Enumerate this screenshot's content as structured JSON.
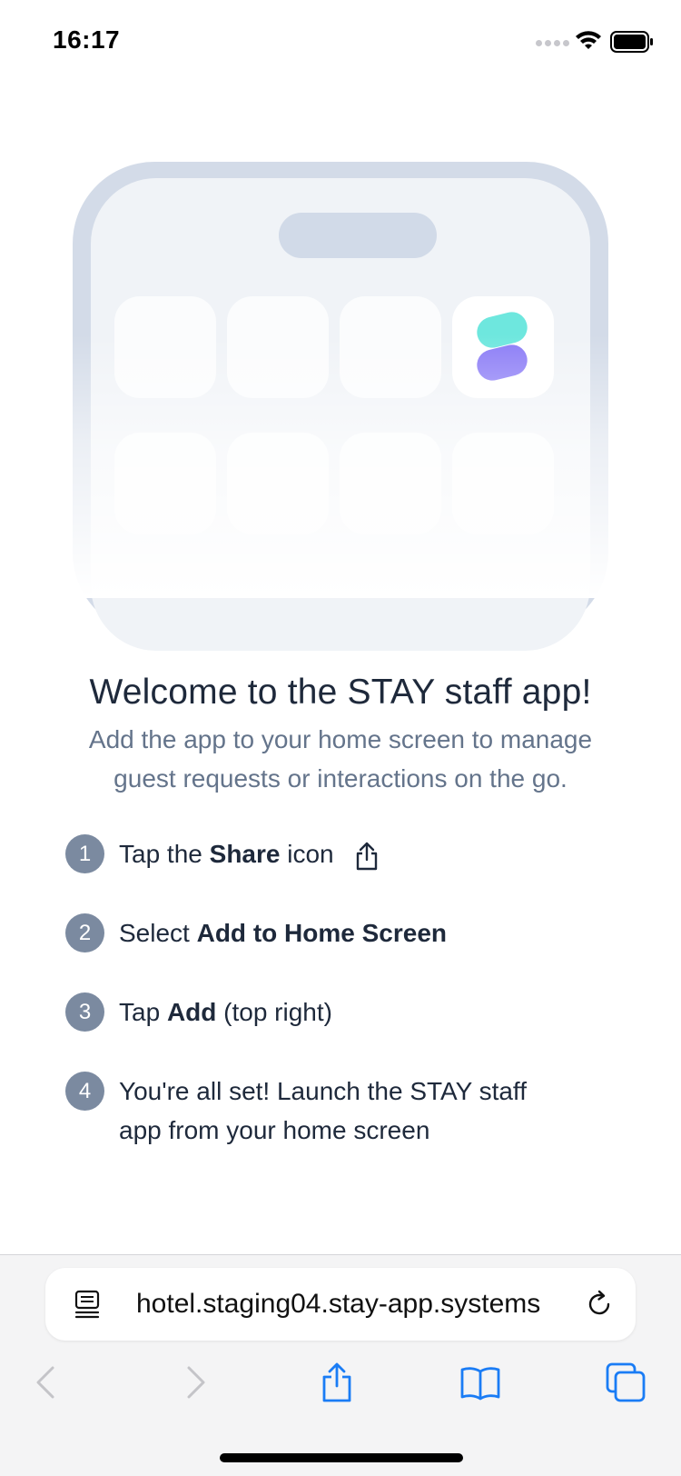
{
  "status_bar": {
    "time": "16:17",
    "icons": [
      "signal-dots-icon",
      "wifi-icon",
      "battery-icon"
    ]
  },
  "illustration": {
    "app_icon": "stay-logo-icon",
    "colors": {
      "frame": "#d3dbe8",
      "screen": "#f0f3f7",
      "logo_teal": "#6ee7de",
      "logo_purple": "#8b7cf6"
    }
  },
  "welcome": {
    "title": "Welcome to the STAY staff app!",
    "subtitle_line1": "Add the app to your home screen to manage",
    "subtitle_line2": "guest requests or interactions on the go."
  },
  "steps": [
    {
      "number": "1",
      "pre": "Tap the ",
      "bold": "Share",
      "post": " icon",
      "icon": "share-icon"
    },
    {
      "number": "2",
      "pre": "Select ",
      "bold": "Add to Home Screen",
      "post": ""
    },
    {
      "number": "3",
      "pre": "Tap ",
      "bold": "Add",
      "post": " (top right)"
    },
    {
      "number": "4",
      "line1": "You're all set! Launch the STAY staff",
      "line2": "app from your home screen"
    }
  ],
  "browser": {
    "url": "hotel.staging04.stay-app.systems",
    "toolbar": [
      "back-icon",
      "forward-icon",
      "share-icon",
      "bookmarks-icon",
      "tabs-icon"
    ],
    "accent_color": "#1a7cf5"
  }
}
